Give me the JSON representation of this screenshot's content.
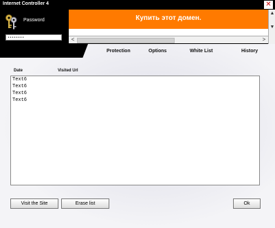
{
  "window": {
    "title": "Internet Controller 4",
    "close_glyph": "✕"
  },
  "login": {
    "password_label": "Password",
    "password_value": "••••••••",
    "icon": "keys-icon"
  },
  "banner": {
    "text": "Купить этот домен.",
    "color": "#ff7a00"
  },
  "scroll": {
    "left": "<",
    "right": ">",
    "up": "▲",
    "down": "▼"
  },
  "tabs": [
    {
      "label": "Protection"
    },
    {
      "label": "Options"
    },
    {
      "label": "White List"
    },
    {
      "label": "History"
    }
  ],
  "history": {
    "columns": {
      "date": "Date",
      "url": "Visited Url"
    },
    "rows": [
      "Text6",
      "Text6",
      "Text6",
      "Text6"
    ]
  },
  "buttons": {
    "visit": "Visit the Site",
    "erase": "Erase list",
    "ok": "Ok"
  }
}
